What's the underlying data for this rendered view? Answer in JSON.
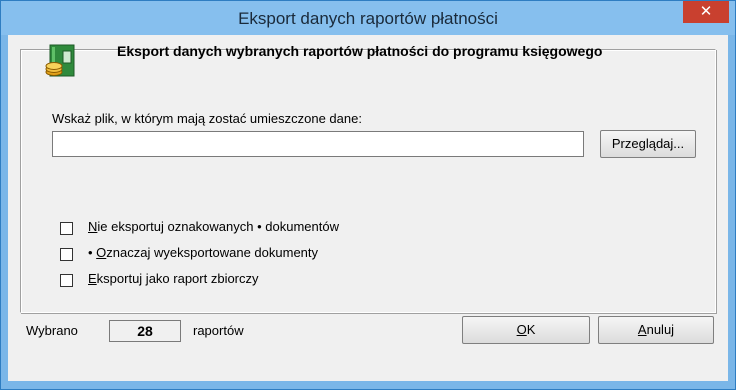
{
  "window": {
    "title": "Eksport danych raportów płatności",
    "close_glyph": "✕"
  },
  "heading": "Eksport danych wybranych raportów płatności do programu księgowego",
  "file_prompt": "Wskaż plik, w którym mają zostać umieszczone dane:",
  "file_input": {
    "value": "",
    "placeholder": ""
  },
  "browse_label": "Przeglądaj...",
  "options": [
    {
      "underline": "N",
      "rest": "ie eksportuj oznakowanych • dokumentów",
      "checked": false
    },
    {
      "prefix": "• ",
      "underline": "O",
      "rest": "znaczaj wyeksportowane dokumenty",
      "checked": false
    },
    {
      "underline": "E",
      "rest": "ksportuj jako raport zbiorczy",
      "checked": false
    }
  ],
  "status": {
    "selected_label": "Wybrano",
    "count": "28",
    "unit": "raportów"
  },
  "ok": {
    "underline": "O",
    "rest": "K"
  },
  "cancel": {
    "underline": "A",
    "rest": "nuluj"
  },
  "icon": "binder-with-coins-icon"
}
